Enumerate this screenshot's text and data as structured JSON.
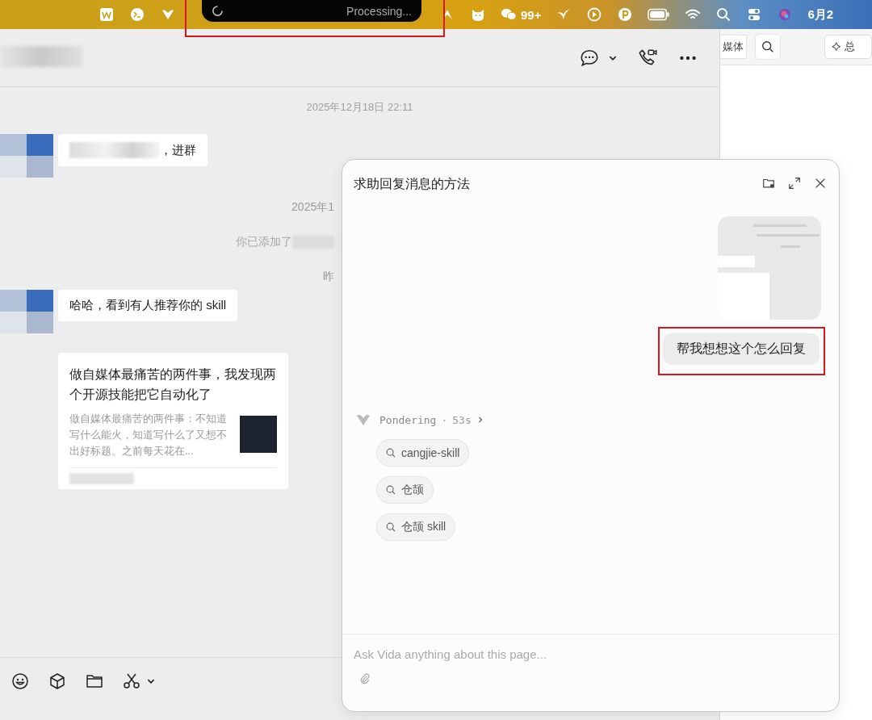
{
  "menu_bar": {
    "notch_status": "Processing...",
    "wechat_badge": "99+",
    "clock": "6月2"
  },
  "chat": {
    "timeline": [
      {
        "kind": "timestamp",
        "text": "2025年12月18日 22:11"
      },
      {
        "kind": "incoming",
        "text": "，进群",
        "redacted": true
      },
      {
        "kind": "clipped",
        "text": "2025年1",
        "redacted": false
      },
      {
        "kind": "clipped",
        "text": "你已添加了",
        "redacted": true
      },
      {
        "kind": "clipped",
        "text": "昨",
        "redacted": false
      },
      {
        "kind": "incoming",
        "text": "哈哈，看到有人推荐你的 skill",
        "redacted": false
      },
      {
        "kind": "link_card",
        "title": "做自媒体最痛苦的两件事，我发现两个开源技能把它自动化了",
        "summary": "做自媒体最痛苦的两件事：不知道写什么能火，知道写什么了又想不出好标题。之前每天花在...",
        "redacted": true
      }
    ]
  },
  "side_window": {
    "tab_label": "媒体",
    "summary_button": "总"
  },
  "assistant_panel": {
    "title": "求助回复消息的方法",
    "user_message": "帮我想想这个怎么回复",
    "status": {
      "label": "Pondering",
      "separator": "·",
      "duration": "53s"
    },
    "searches": [
      "cangjie-skill",
      "仓颉",
      "仓颉 skill"
    ],
    "input": {
      "placeholder": "Ask Vida anything about this page..."
    }
  }
}
